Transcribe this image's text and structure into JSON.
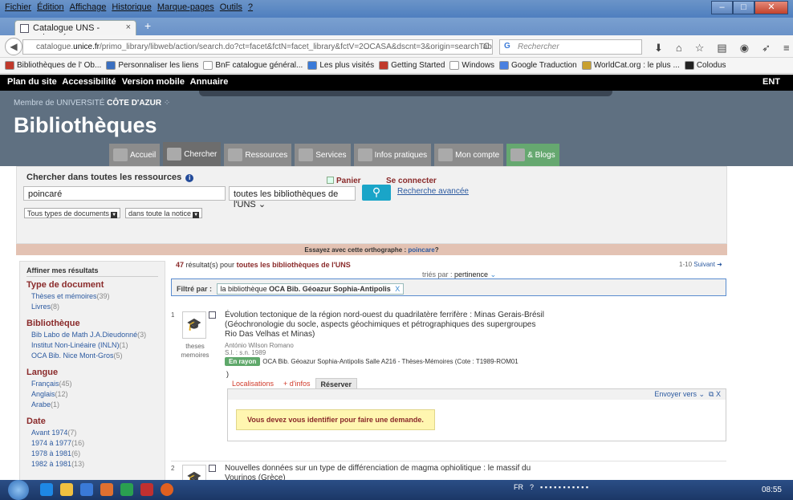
{
  "browser": {
    "menu": [
      "Fichier",
      "Édition",
      "Affichage",
      "Historique",
      "Marque-pages",
      "Outils",
      "?"
    ],
    "tab_title": "Catalogue UNS - poincaré",
    "tab_close": "×",
    "new_tab": "+",
    "url_prefix": "catalogue.",
    "url_domain": "unice.fr",
    "url_rest": "/primo_library/libweb/action/search.do?ct=facet&fctN=facet_library&fctV=2OCASA&dscnt=3&origin=searchTabForr",
    "search_placeholder": "Rechercher",
    "bookmarks": [
      {
        "label": "Bibliothèques de l' Ob...",
        "color": "#c0392b"
      },
      {
        "label": "Personnaliser les liens",
        "color": "#3a6fc0"
      },
      {
        "label": "BnF catalogue général...",
        "color": "#ffffff"
      },
      {
        "label": "Les plus visités",
        "color": "#3a7ad8"
      },
      {
        "label": "Getting Started",
        "color": "#c0392b"
      },
      {
        "label": "Windows",
        "color": "#ffffff"
      },
      {
        "label": "Google Traduction",
        "color": "#4a80e0"
      },
      {
        "label": "WorldCat.org : le plus ...",
        "color": "#c8a030"
      },
      {
        "label": "Colodus",
        "color": "#222222"
      }
    ]
  },
  "site": {
    "top_links": [
      "Plan du site",
      "Accessibilité",
      "Version mobile",
      "Annuaire"
    ],
    "ent": "ENT",
    "membre_prefix": "Membre de UNIVERSITÉ",
    "membre_brand": "CÔTE D'AZUR",
    "title": "Bibliothèques",
    "nav": [
      {
        "label": "Accueil",
        "active": false
      },
      {
        "label": "Chercher",
        "active": true
      },
      {
        "label": "Ressources",
        "active": false
      },
      {
        "label": "Services",
        "active": false
      },
      {
        "label": "Infos pratiques",
        "active": false
      },
      {
        "label": "Mon compte",
        "active": false
      },
      {
        "label": "& Blogs",
        "active": false
      }
    ]
  },
  "search": {
    "label": "Chercher dans toutes les ressources",
    "panier": "Panier",
    "connect": "Se connecter",
    "query": "poincaré",
    "scope": "toutes les bibliothèques de l'UNS",
    "advanced": "Recherche avancée",
    "doc_types": "Tous types de documents",
    "where": "dans toute la notice",
    "suggest_prefix": "Essayez avec cette orthographe :",
    "suggest_term": "poincare",
    "suggest_suffix": "?"
  },
  "facets": {
    "title": "Affiner mes résultats",
    "groups": [
      {
        "name": "Type de document",
        "items": [
          {
            "label": "Thèses et mémoires",
            "count": "(39)"
          },
          {
            "label": "Livres",
            "count": "(8)"
          }
        ]
      },
      {
        "name": "Bibliothèque",
        "items": [
          {
            "label": "Bib Labo de Math J.A.Dieudonné",
            "count": "(3)"
          },
          {
            "label": "Institut Non-Linéaire (INLN)",
            "count": "(1)"
          },
          {
            "label": "OCA Bib. Nice Mont-Gros",
            "count": "(5)"
          }
        ]
      },
      {
        "name": "Langue",
        "items": [
          {
            "label": "Français",
            "count": "(45)"
          },
          {
            "label": "Anglais",
            "count": "(12)"
          },
          {
            "label": "Arabe",
            "count": "(1)"
          }
        ]
      },
      {
        "name": "Date",
        "items": [
          {
            "label": "Avant 1974",
            "count": "(7)"
          },
          {
            "label": "1974 à 1977",
            "count": "(16)"
          },
          {
            "label": "1978 à 1981",
            "count": "(6)"
          },
          {
            "label": "1982 à 1981",
            "count": "(13)"
          }
        ]
      }
    ]
  },
  "results": {
    "count": "47",
    "summary_mid": "résultat(s) pour",
    "scope": "toutes les bibliothèques de l'UNS",
    "pager": "1-10",
    "next": "Suivant",
    "sort_label": "triés par :",
    "sort_value": "pertinence",
    "filter_label": "Filtré par :",
    "filter_prefix": "la bibliothèque",
    "filter_value": "OCA Bib. Géoazur Sophia-Antipolis",
    "filter_remove": "X",
    "records": [
      {
        "num": "1",
        "type": "theses memoires",
        "title": "Évolution tectonique de la région nord-ouest du quadrilatère ferrifère : Minas Gerais-Brésil (Géochronologie du socle, aspects géochimiques et pétrographiques des supergroupes Rio Das Velhas et Minas)",
        "author": "António Wilson Romano",
        "pub": "S.l. : s.n. 1989",
        "status": "En rayon",
        "location": "OCA Bib. Géoazur Sophia-Antipolis Salle A216 - Thèses-Mémoires (Cote : T1989-ROM01",
        "paren": ")",
        "tabs": [
          "Localisations",
          "+ d'infos",
          "Réserver"
        ],
        "send": "Envoyer vers",
        "close": "X",
        "warning": "Vous devez vous identifier pour faire une demande."
      },
      {
        "num": "2",
        "title": "Nouvelles données sur un type de différenciation de magma ophiolitique : le massif du Vourinos (Grèce)"
      }
    ]
  },
  "taskbar": {
    "lang": "FR",
    "clock": "08:55"
  }
}
